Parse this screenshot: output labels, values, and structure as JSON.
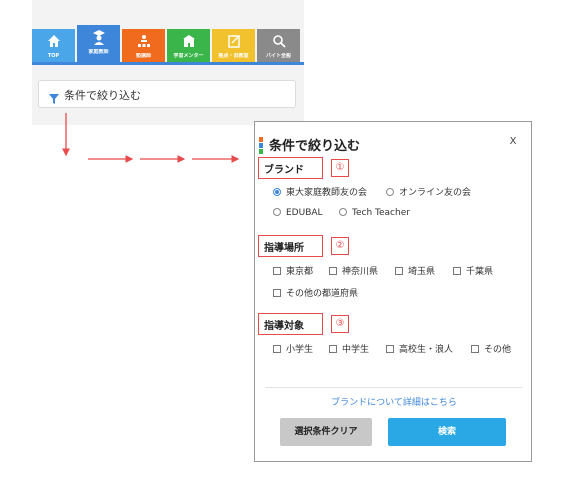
{
  "tabs": [
    {
      "label": "TOP",
      "icon": "home-icon",
      "color": "#4aa6e8"
    },
    {
      "label": "家庭教師",
      "icon": "graduate-icon",
      "color": "#3d86d9"
    },
    {
      "label": "塾講師",
      "icon": "classroom-icon",
      "color": "#f06b1e"
    },
    {
      "label": "学習メンター",
      "icon": "school-icon",
      "color": "#39b54a"
    },
    {
      "label": "拠点・旧教室",
      "icon": "notepad-icon",
      "color": "#f2c12e"
    },
    {
      "label": "バイト全般",
      "icon": "search-icon",
      "color": "#8a8a8a"
    }
  ],
  "filter_bar": {
    "label": "条件で絞り込む"
  },
  "modal": {
    "title": "条件で絞り込む",
    "close_label": "X",
    "sections": {
      "brand": {
        "title": "ブランド",
        "badge": "①",
        "options": [
          "東大家庭教師友の会",
          "オンライン友の会",
          "EDUBAL",
          "Tech Teacher"
        ],
        "selected": "東大家庭教師友の会"
      },
      "location": {
        "title": "指導場所",
        "badge": "②",
        "options": [
          "東京都",
          "神奈川県",
          "埼玉県",
          "千葉県",
          "その他の都道府県"
        ]
      },
      "target": {
        "title": "指導対象",
        "badge": "③",
        "options": [
          "小学生",
          "中学生",
          "高校生・浪人",
          "その他"
        ]
      }
    },
    "brand_link": "ブランドについて詳細はこちら",
    "clear_button": "選択条件クリア",
    "search_button": "検索"
  },
  "colors": {
    "accent_blue": "#3d86d9",
    "highlight_red": "#e84b4b",
    "search_button": "#2aa8e6",
    "clear_button": "#c8c8c8"
  }
}
